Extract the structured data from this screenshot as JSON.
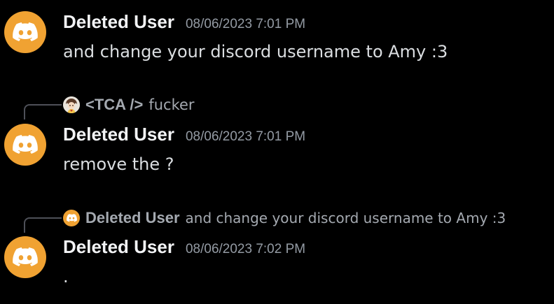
{
  "messages": [
    {
      "username": "Deleted User",
      "timestamp": "08/06/2023 7:01 PM",
      "content": "and change your discord username to Amy :3",
      "avatar_icon": "discord-logo-icon"
    },
    {
      "reply": {
        "username": "<TCA />",
        "content": "fucker",
        "avatar_icon": "anime-character-avatar"
      },
      "username": "Deleted User",
      "timestamp": "08/06/2023 7:01 PM",
      "content": "remove the ?",
      "avatar_icon": "discord-logo-icon"
    },
    {
      "reply": {
        "username": "Deleted User",
        "content": "and change your discord username to Amy :3",
        "avatar_icon": "discord-logo-icon"
      },
      "username": "Deleted User",
      "timestamp": "08/06/2023 7:02 PM",
      "content": ".",
      "avatar_icon": "discord-logo-icon"
    }
  ],
  "colors": {
    "background": "#000000",
    "avatar": "#f0a232",
    "username": "#f2f3f5",
    "timestamp": "#949ba4",
    "content": "#dbdee1",
    "reply_text": "#a4a9b0",
    "reply_spine": "#4e5058"
  }
}
